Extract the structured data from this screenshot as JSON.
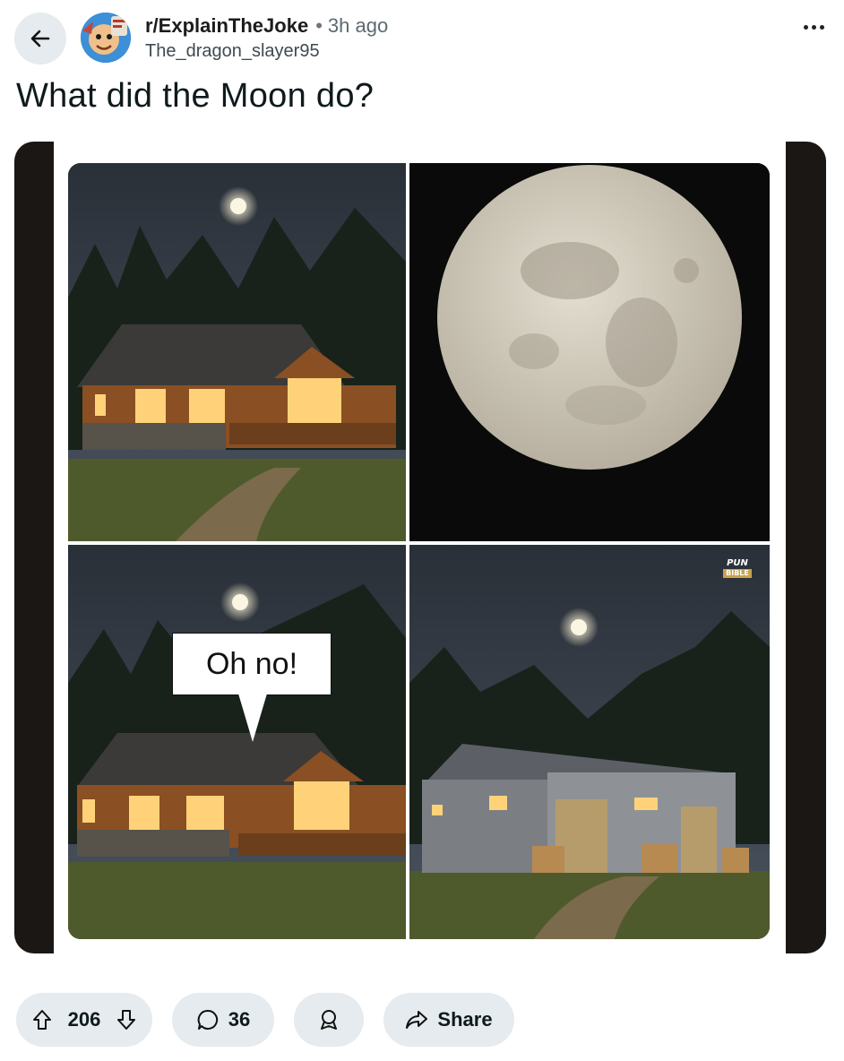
{
  "header": {
    "subreddit": "r/ExplainTheJoke",
    "separator": "•",
    "time_ago": "3h ago",
    "username": "The_dragon_slayer95",
    "back_icon": "arrow-left-icon",
    "more_icon": "ellipsis-icon"
  },
  "post": {
    "title": "What did the Moon do?"
  },
  "image": {
    "panels": [
      "cabin-with-moon",
      "full-moon-closeup",
      "cabin-with-speech-bubble",
      "warehouse-with-moon"
    ],
    "speech_bubble": "Oh no!",
    "watermark_top": "PUN",
    "watermark_bottom": "BIBLE"
  },
  "actions": {
    "upvotes": "206",
    "comments": "36",
    "share_label": "Share",
    "icons": [
      "upvote-icon",
      "downvote-icon",
      "comment-icon",
      "award-icon",
      "share-icon"
    ]
  },
  "colors": {
    "button_bg": "#e5ebee",
    "text": "#0f1a1c",
    "avatar_bg": "#3d8fd6"
  }
}
